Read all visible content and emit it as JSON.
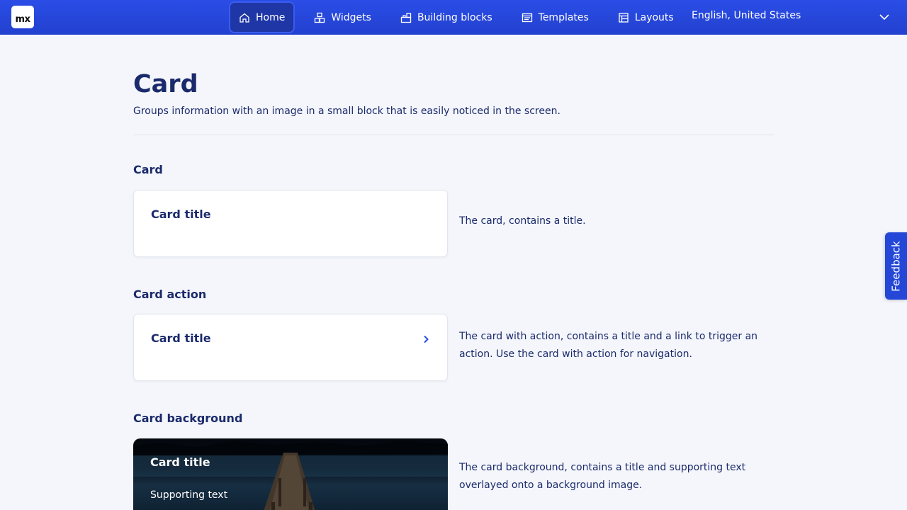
{
  "header": {
    "logo_text": "mx",
    "nav": [
      {
        "label": "Home",
        "icon": "home-icon",
        "active": true
      },
      {
        "label": "Widgets",
        "icon": "widgets-icon",
        "active": false
      },
      {
        "label": "Building blocks",
        "icon": "building-blocks-icon",
        "active": false
      },
      {
        "label": "Templates",
        "icon": "templates-icon",
        "active": false
      },
      {
        "label": "Layouts",
        "icon": "layouts-icon",
        "active": false
      }
    ],
    "language": "English, United States",
    "accent_color": "#2a4de6"
  },
  "page": {
    "title": "Card",
    "subtitle": "Groups information with an image in a small block that is easily noticed in the screen."
  },
  "sections": [
    {
      "heading": "Card",
      "card_title": "Card title",
      "description": "The card, contains a title."
    },
    {
      "heading": "Card action",
      "card_title": "Card title",
      "description": "The card with action, contains a title and a link to trigger an action. Use the card with action for navigation."
    },
    {
      "heading": "Card background",
      "card_title": "Card title",
      "supporting_text": "Supporting text",
      "description": "The card background, contains a title and supporting text overlayed onto a background image."
    }
  ],
  "feedback_label": "Feedback"
}
